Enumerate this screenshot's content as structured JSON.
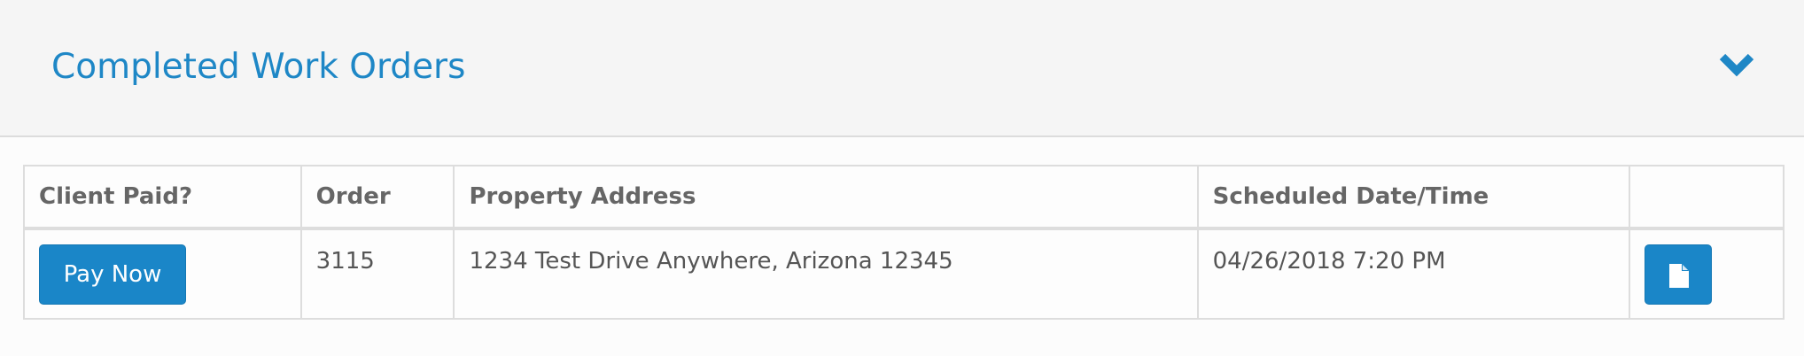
{
  "panel": {
    "title": "Completed Work Orders",
    "toggle_icon": "chevron-down-icon",
    "accent_color": "#1e87c6"
  },
  "table": {
    "columns": [
      "Client Paid?",
      "Order",
      "Property Address",
      "Scheduled Date/Time",
      ""
    ],
    "rows": [
      {
        "client_paid_action": "Pay Now",
        "order": "3115",
        "property_address": "1234 Test Drive Anywhere, Arizona 12345",
        "scheduled": "04/26/2018 7:20 PM",
        "document_icon": "document-icon"
      }
    ]
  }
}
